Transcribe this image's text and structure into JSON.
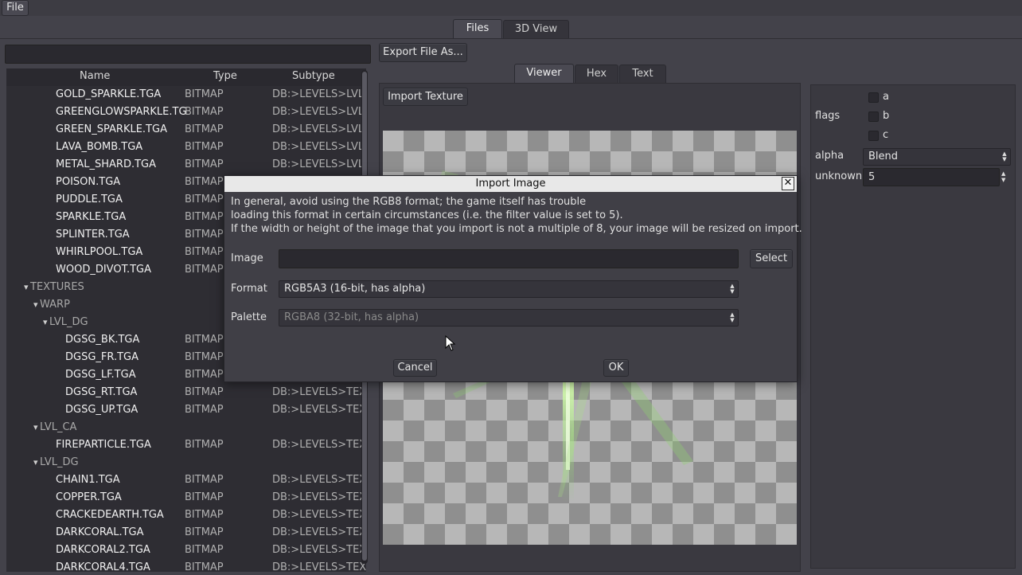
{
  "menu": {
    "file": "File"
  },
  "main_tabs": [
    "Files",
    "3D View"
  ],
  "search": {
    "value": ""
  },
  "tree": {
    "headers": {
      "name": "Name",
      "type": "Type",
      "subtype": "Subtype"
    },
    "rows": [
      {
        "kind": "file",
        "name": "GOLD_SPARKLE.TGA",
        "type": "BITMAP",
        "subtype": "DB:>LEVELS>LVL"
      },
      {
        "kind": "file",
        "name": "GREENGLOWSPARKLE.TG",
        "type": "BITMAP",
        "subtype": "DB:>LEVELS>LVL"
      },
      {
        "kind": "file",
        "name": "GREEN_SPARKLE.TGA",
        "type": "BITMAP",
        "subtype": "DB:>LEVELS>LVL"
      },
      {
        "kind": "file",
        "name": "LAVA_BOMB.TGA",
        "type": "BITMAP",
        "subtype": "DB:>LEVELS>LVL"
      },
      {
        "kind": "file",
        "name": "METAL_SHARD.TGA",
        "type": "BITMAP",
        "subtype": "DB:>LEVELS>LVL"
      },
      {
        "kind": "file",
        "name": "POISON.TGA",
        "type": "BITMAP",
        "subtype": ""
      },
      {
        "kind": "file",
        "name": "PUDDLE.TGA",
        "type": "BITMAP",
        "subtype": ""
      },
      {
        "kind": "file",
        "name": "SPARKLE.TGA",
        "type": "BITMAP",
        "subtype": ""
      },
      {
        "kind": "file",
        "name": "SPLINTER.TGA",
        "type": "BITMAP",
        "subtype": ""
      },
      {
        "kind": "file",
        "name": "WHIRLPOOL.TGA",
        "type": "BITMAP",
        "subtype": ""
      },
      {
        "kind": "file",
        "name": "WOOD_DIVOT.TGA",
        "type": "BITMAP",
        "subtype": ""
      },
      {
        "kind": "folder",
        "name": "TEXTURES",
        "indent": 0
      },
      {
        "kind": "folder",
        "name": "WARP",
        "indent": 1
      },
      {
        "kind": "folder",
        "name": "LVL_DG",
        "indent": 2
      },
      {
        "kind": "file2",
        "name": "DGSG_BK.TGA",
        "type": "BITMAP",
        "subtype": ""
      },
      {
        "kind": "file2",
        "name": "DGSG_FR.TGA",
        "type": "BITMAP",
        "subtype": ""
      },
      {
        "kind": "file2",
        "name": "DGSG_LF.TGA",
        "type": "BITMAP",
        "subtype": ""
      },
      {
        "kind": "file2",
        "name": "DGSG_RT.TGA",
        "type": "BITMAP",
        "subtype": "DB:>LEVELS>TEX"
      },
      {
        "kind": "file2",
        "name": "DGSG_UP.TGA",
        "type": "BITMAP",
        "subtype": "DB:>LEVELS>TEX"
      },
      {
        "kind": "folder",
        "name": "LVL_CA",
        "indent": 1
      },
      {
        "kind": "file",
        "name": "FIREPARTICLE.TGA",
        "type": "BITMAP",
        "subtype": "DB:>LEVELS>TEX"
      },
      {
        "kind": "folder",
        "name": "LVL_DG",
        "indent": 1
      },
      {
        "kind": "file",
        "name": "CHAIN1.TGA",
        "type": "BITMAP",
        "subtype": "DB:>LEVELS>TEX"
      },
      {
        "kind": "file",
        "name": "COPPER.TGA",
        "type": "BITMAP",
        "subtype": "DB:>LEVELS>TEX"
      },
      {
        "kind": "file",
        "name": "CRACKEDEARTH.TGA",
        "type": "BITMAP",
        "subtype": "DB:>LEVELS>TEX"
      },
      {
        "kind": "file",
        "name": "DARKCORAL.TGA",
        "type": "BITMAP",
        "subtype": "DB:>LEVELS>TEX"
      },
      {
        "kind": "file",
        "name": "DARKCORAL2.TGA",
        "type": "BITMAP",
        "subtype": "DB:>LEVELS>TEX"
      },
      {
        "kind": "file",
        "name": "DARKCORAL4.TGA",
        "type": "BITMAP",
        "subtype": "DB:>LEVELS>TEX"
      }
    ]
  },
  "export_button": "Export File As...",
  "viewer_tabs": [
    "Viewer",
    "Hex",
    "Text"
  ],
  "import_texture_button": "Import Texture",
  "props": {
    "flags_label": "flags",
    "flags": [
      "a",
      "b",
      "c"
    ],
    "alpha_label": "alpha",
    "alpha_value": "Blend",
    "unknown_label": "unknown",
    "unknown_value": "5"
  },
  "dialog": {
    "title": "Import Image",
    "line1": "In general, avoid using the RGB8 format; the game itself has trouble",
    "line2": "loading this format in certain circumstances (i.e. the filter value is set to 5).",
    "line3": "If the width or height of the image that you import is not a multiple of 8, your image will be resized on import.",
    "image_label": "Image",
    "image_value": "",
    "select_button": "Select",
    "format_label": "Format",
    "format_value": "RGB5A3 (16-bit, has alpha)",
    "palette_label": "Palette",
    "palette_value": "RGBA8 (32-bit, has alpha)",
    "cancel_button": "Cancel",
    "ok_button": "OK"
  }
}
